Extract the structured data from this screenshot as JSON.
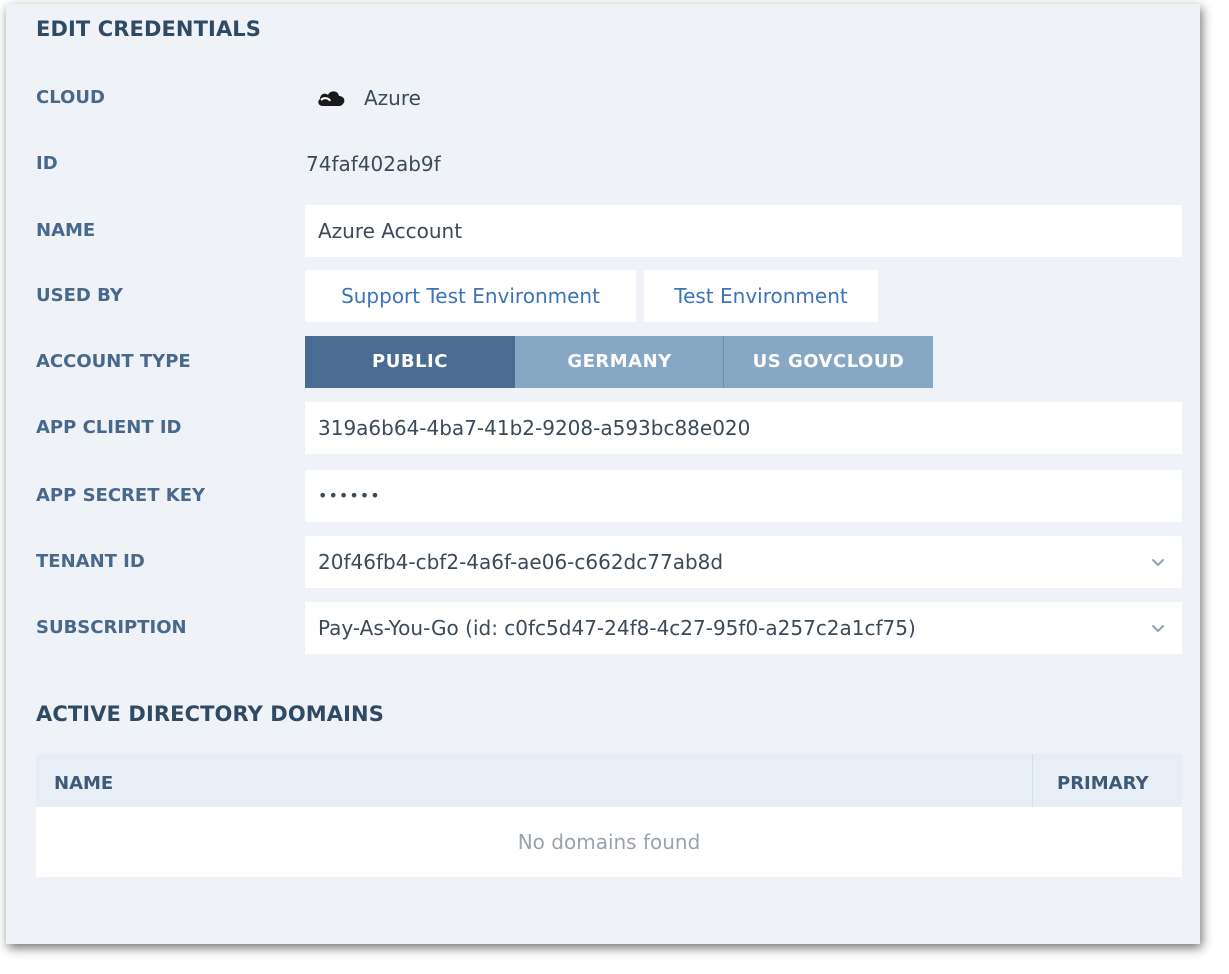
{
  "title": "EDIT CREDENTIALS",
  "cloud": {
    "label": "CLOUD",
    "value": "Azure",
    "icon": "cloud-icon"
  },
  "id": {
    "label": "ID",
    "value": "74faf402ab9f"
  },
  "name": {
    "label": "NAME",
    "value": "Azure Account"
  },
  "used_by": {
    "label": "USED BY",
    "items": [
      "Support Test Environment",
      "Test Environment"
    ]
  },
  "account_type": {
    "label": "ACCOUNT TYPE",
    "options": [
      "PUBLIC",
      "GERMANY",
      "US GOVCLOUD"
    ],
    "selected": "PUBLIC"
  },
  "app_client_id": {
    "label": "APP CLIENT ID",
    "value": "319a6b64-4ba7-41b2-9208-a593bc88e020"
  },
  "app_secret_key": {
    "label": "APP SECRET KEY",
    "value": "••••••"
  },
  "tenant_id": {
    "label": "TENANT ID",
    "value": "20f46fb4-cbf2-4a6f-ae06-c662dc77ab8d",
    "icon": "chevron-down-icon"
  },
  "subscription": {
    "label": "SUBSCRIPTION",
    "value": "Pay-As-You-Go (id: c0fc5d47-24f8-4c27-95f0-a257c2a1cf75)",
    "icon": "chevron-down-icon"
  },
  "domains": {
    "title": "ACTIVE DIRECTORY DOMAINS",
    "columns": [
      "NAME",
      "PRIMARY"
    ],
    "empty_text": "No domains found"
  },
  "colors": {
    "panel_bg": "#eff3f8",
    "label": "#48698b",
    "link": "#3c74b8",
    "segment_active": "#4a6c93",
    "segment_inactive": "#86a8c4"
  }
}
